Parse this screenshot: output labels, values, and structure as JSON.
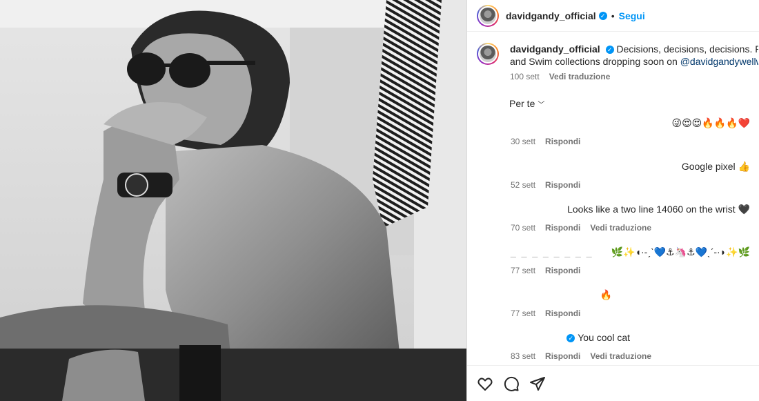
{
  "post": {
    "username": "davidgandy_official",
    "follow_label": "Segui",
    "dot": "•",
    "caption": {
      "username": "davidgandy_official",
      "text_line1": "Decisions, decisions, decisions. Poolside",
      "text_line2": "and Swim collections dropping soon on",
      "mention": "@davidgandywellwear",
      "time": "100 sett",
      "translate": "Vedi traduzione"
    },
    "sort_label": "Per te"
  },
  "comments": [
    {
      "text": "😜😍😍🔥🔥🔥❤️",
      "time": "30 sett",
      "reply": "Rispondi",
      "translate": ""
    },
    {
      "text": "Google pixel 👍",
      "time": "52 sett",
      "reply": "Rispondi",
      "translate": ""
    },
    {
      "text": "Looks like a two line 14060 on the wrist 🖤",
      "time": "70 sett",
      "reply": "Rispondi",
      "translate": "Vedi traduzione"
    },
    {
      "text": "🌿✨◖·-ˏˋ💙⚓🦄⚓💙ˎˊ-·◗✨🌿",
      "prefix": "_ _ _ _ _ _ _ _",
      "time": "77 sett",
      "reply": "Rispondi",
      "translate": ""
    },
    {
      "text": "🔥",
      "time": "77 sett",
      "reply": "Rispondi",
      "translate": ""
    },
    {
      "text": "You cool cat",
      "time": "83 sett",
      "reply": "Rispondi",
      "translate": "Vedi traduzione"
    }
  ],
  "icons": {
    "like": "heart-icon",
    "comment": "comment-icon",
    "share": "share-icon"
  },
  "colors": {
    "accent": "#0095f6",
    "mention": "#00376b",
    "muted": "#737373"
  }
}
